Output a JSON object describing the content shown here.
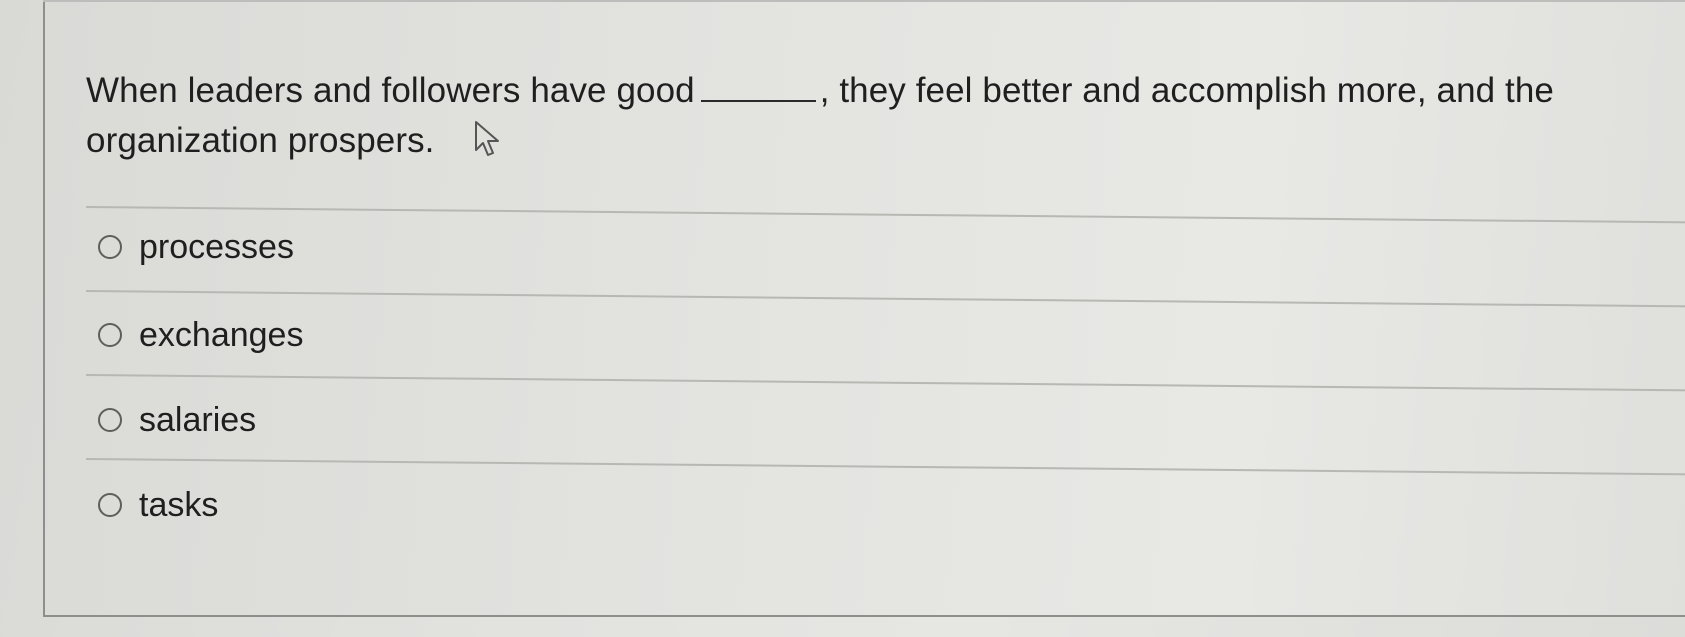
{
  "question": {
    "part1": "When leaders and followers have good",
    "part2": ", they feel better and accomplish more, and the organization prospers."
  },
  "options": [
    {
      "label": "processes",
      "selected": false
    },
    {
      "label": "exchanges",
      "selected": false
    },
    {
      "label": "salaries",
      "selected": false
    },
    {
      "label": "tasks",
      "selected": false
    }
  ],
  "icons": {
    "cursor": "mouse-pointer-icon",
    "radio": "radio-unchecked-icon"
  }
}
